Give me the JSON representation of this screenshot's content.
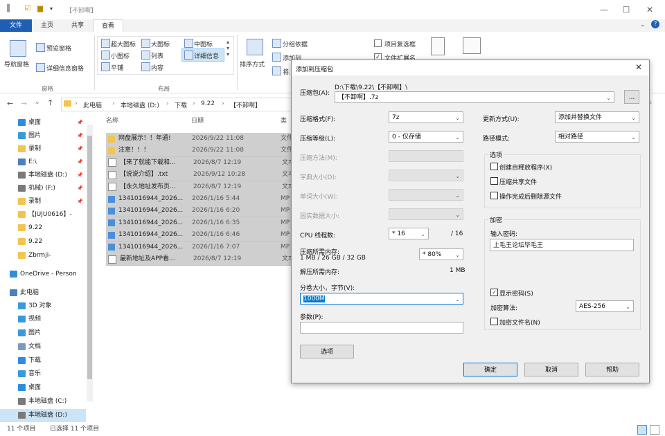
{
  "window": {
    "title": "【不卸啊】"
  },
  "ribbon": {
    "tabs": [
      "文件",
      "主页",
      "共享",
      "查看"
    ],
    "nav_pane": "导航窗格",
    "preview_pane": "预览窗格",
    "details_pane": "详细信息窗格",
    "group_panes": "窗格",
    "layout": [
      "超大图标",
      "大图标",
      "中图标",
      "小图标",
      "列表",
      "详细信息",
      "平铺",
      "内容"
    ],
    "group_layout": "布局",
    "sort_by": "排序方式",
    "group_by": "分组依据",
    "add_columns": "添加列",
    "fit_columns": "将所有列调整为合适的大小",
    "item_checkboxes": "项目复选框",
    "file_extensions": "文件扩展名"
  },
  "address": {
    "crumbs": [
      "此电脑",
      "本地磁盘 (D:)",
      "下载",
      "9.22",
      "【不卸啊】"
    ]
  },
  "nav": {
    "items": [
      {
        "label": "桌面",
        "pinned": true
      },
      {
        "label": "图片",
        "pinned": true
      },
      {
        "label": "录制",
        "pinned": true
      },
      {
        "label": "E:\\",
        "pinned": true
      },
      {
        "label": "本地磁盘 (D:)",
        "pinned": true
      },
      {
        "label": "机械) (F:)",
        "pinned": true
      },
      {
        "label": "录制",
        "pinned": true
      },
      {
        "label": "【JUJU0616】-",
        "pinned": false
      },
      {
        "label": "9.22",
        "pinned": false
      },
      {
        "label": "9.22",
        "pinned": false
      },
      {
        "label": "Zbrmji-",
        "pinned": false
      },
      {
        "label": "OneDrive - Person",
        "pinned": false
      },
      {
        "label": "此电脑",
        "pinned": false
      },
      {
        "label": "3D 对象",
        "pinned": false
      },
      {
        "label": "视频",
        "pinned": false
      },
      {
        "label": "图片",
        "pinned": false
      },
      {
        "label": "文档",
        "pinned": false
      },
      {
        "label": "下载",
        "pinned": false
      },
      {
        "label": "音乐",
        "pinned": false
      },
      {
        "label": "桌面",
        "pinned": false
      },
      {
        "label": "本地磁盘 (C:)",
        "pinned": false
      },
      {
        "label": "本地磁盘 (D:)",
        "pinned": false
      }
    ]
  },
  "list": {
    "columns": [
      "名称",
      "日期",
      "类"
    ],
    "rows": [
      {
        "name": "网盘展示！！年通!",
        "date": "2026/9/22 11:08",
        "type": "文件",
        "icon": "folder"
      },
      {
        "name": "注意！！！",
        "date": "2026/9/22 11:08",
        "type": "文件",
        "icon": "folder"
      },
      {
        "name": "【来了就能下载和...",
        "date": "2026/8/7 12:19",
        "type": "文本",
        "icon": "text"
      },
      {
        "name": "【说说介绍】.txt",
        "date": "2026/9/12 10:28",
        "type": "文本",
        "icon": "text"
      },
      {
        "name": "【永久地址发布页...",
        "date": "2026/8/7 12:19",
        "type": "文本",
        "icon": "text"
      },
      {
        "name": "1341016944_2026...",
        "date": "2026/1/16 5:44",
        "type": "MP",
        "icon": "video"
      },
      {
        "name": "1341016944_2026...",
        "date": "2026/1/16 6:20",
        "type": "MP",
        "icon": "video"
      },
      {
        "name": "1341016944_2026...",
        "date": "2026/1/16 6:35",
        "type": "MP",
        "icon": "video"
      },
      {
        "name": "1341016944_2026...",
        "date": "2026/1/16 6:46",
        "type": "MP",
        "icon": "video"
      },
      {
        "name": "1341016944_2026...",
        "date": "2026/1/16 7:07",
        "type": "MP",
        "icon": "video"
      },
      {
        "name": "最新地址及APP看...",
        "date": "2026/8/7 12:19",
        "type": "文本",
        "icon": "text"
      }
    ]
  },
  "status": {
    "count": "11 个项目",
    "selected": "已选择 11 个项目"
  },
  "dialog": {
    "title": "添加到压缩包",
    "archive_label": "压缩包(A):",
    "archive_path": "D:\\下载\\9.22\\【不卸啊】\\",
    "archive_name": "【不卸啊】.7z",
    "browse": "...",
    "format_label": "压缩格式(F):",
    "format_value": "7z",
    "level_label": "压缩等级(L):",
    "level_value": "0 - 仅存储",
    "method_label": "压缩方法(M):",
    "dict_label": "字典大小(D):",
    "word_label": "单词大小(W):",
    "solid_label": "固实数据大小:",
    "threads_label": "CPU 线程数:",
    "threads_value": "* 16",
    "threads_total": "/ 16",
    "mem_label": "压缩所需内存:",
    "mem_info": "1 MB / 26 GB / 32 GB",
    "mem_pct": "* 80%",
    "decomp_label": "解压所需内存:",
    "decomp_value": "1 MB",
    "split_label": "分卷大小，字节(V):",
    "split_value": "1000M",
    "params_label": "参数(P):",
    "options_btn": "选项",
    "update_label": "更新方式(U):",
    "update_value": "添加并替换文件",
    "pathmode_label": "路径模式:",
    "pathmode_value": "相对路径",
    "options_group": "选项",
    "opt_sfx": "创建自释放程序(X)",
    "opt_shared": "压缩共享文件",
    "opt_delete": "操作完成后删除源文件",
    "enc_group": "加密",
    "pwd_label": "输入密码:",
    "pwd_value": "上毛王论坛毕毛王",
    "show_pwd": "显示密码(S)",
    "enc_method_label": "加密算法:",
    "enc_method_value": "AES-256",
    "enc_names": "加密文件名(N)",
    "ok": "确定",
    "cancel": "取消",
    "help": "帮助"
  },
  "colors": {
    "accent": "#1f5fb3",
    "selection": "#cfcfcf",
    "folder": "#f3c44f"
  }
}
